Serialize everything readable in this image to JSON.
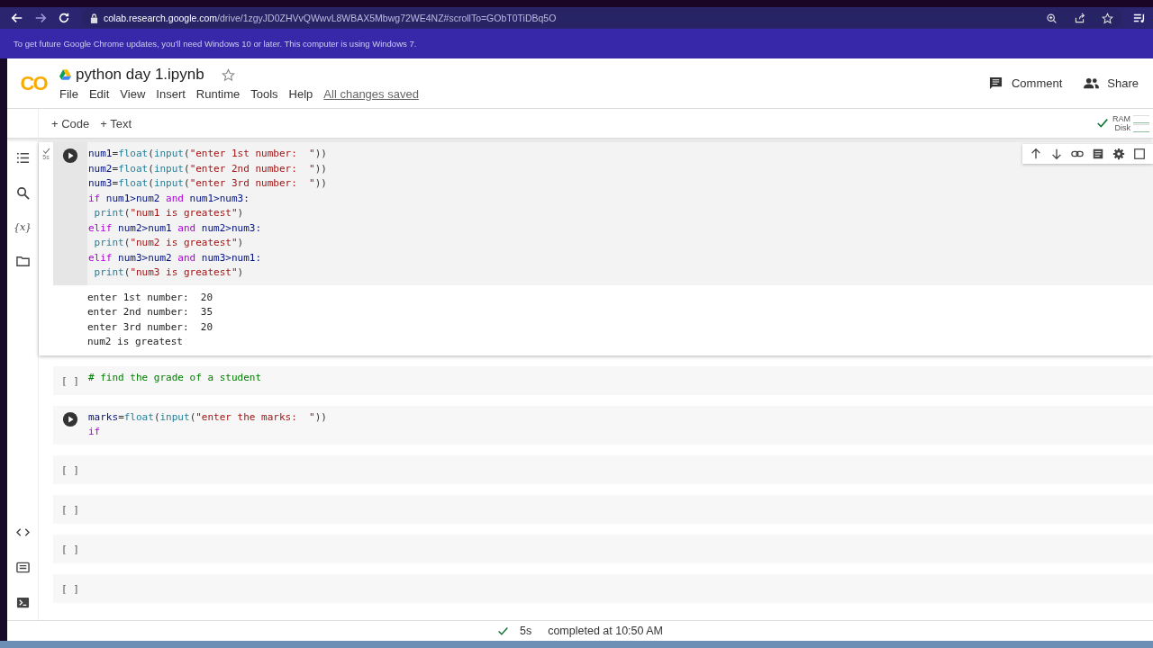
{
  "browser": {
    "url_host": "colab.research.google.com",
    "url_path": "/drive/1zgyJD0ZHVvQWwvL8WBAX5Mbwg72WE4NZ#scrollTo=GObT0TiDBq5O",
    "infobar": "To get future Google Chrome updates, you'll need Windows 10 or later. This computer is using Windows 7."
  },
  "header": {
    "logo": "CO",
    "title": "python day 1.ipynb",
    "menu": [
      "File",
      "Edit",
      "View",
      "Insert",
      "Runtime",
      "Tools",
      "Help"
    ],
    "save_status": "All changes saved",
    "actions": [
      "Comment",
      "Share"
    ]
  },
  "sidebar": {
    "variables_icon": "{x}"
  },
  "toolbar": {
    "buttons": [
      "+ Code",
      "+ Text"
    ],
    "resources": [
      "RAM",
      "Disk"
    ]
  },
  "cells": [
    {
      "kind": "run",
      "selected": true,
      "exec_time": "5s",
      "lines": [
        [
          {
            "t": "num1",
            "kind": "name"
          },
          {
            "t": "=",
            "kind": "operator"
          },
          {
            "t": "float",
            "kind": "function"
          },
          {
            "t": "(",
            "kind": "operator"
          },
          {
            "t": "input",
            "kind": "function"
          },
          {
            "t": "(",
            "kind": "operator"
          },
          {
            "t": "\"enter 1st number:  \"",
            "kind": "string"
          },
          {
            "t": "))",
            "kind": "operator"
          }
        ],
        [
          {
            "t": "num2",
            "kind": "name"
          },
          {
            "t": "=",
            "kind": "operator"
          },
          {
            "t": "float",
            "kind": "function"
          },
          {
            "t": "(",
            "kind": "operator"
          },
          {
            "t": "input",
            "kind": "function"
          },
          {
            "t": "(",
            "kind": "operator"
          },
          {
            "t": "\"enter 2nd number:  \"",
            "kind": "string"
          },
          {
            "t": "))",
            "kind": "operator"
          }
        ],
        [
          {
            "t": "num3",
            "kind": "name"
          },
          {
            "t": "=",
            "kind": "operator"
          },
          {
            "t": "float",
            "kind": "function"
          },
          {
            "t": "(",
            "kind": "operator"
          },
          {
            "t": "input",
            "kind": "function"
          },
          {
            "t": "(",
            "kind": "operator"
          },
          {
            "t": "\"enter 3rd number:  \"",
            "kind": "string"
          },
          {
            "t": "))",
            "kind": "operator"
          }
        ],
        [
          {
            "t": "if",
            "kind": "keyword"
          },
          {
            "t": " num1>num2 ",
            "kind": "name"
          },
          {
            "t": "and",
            "kind": "keyword"
          },
          {
            "t": " num1>num3:",
            "kind": "name"
          }
        ],
        [
          {
            "t": " print",
            "kind": "function"
          },
          {
            "t": "(",
            "kind": "operator"
          },
          {
            "t": "\"num1 is greatest\"",
            "kind": "string"
          },
          {
            "t": ")",
            "kind": "operator"
          }
        ],
        [
          {
            "t": "elif",
            "kind": "keyword"
          },
          {
            "t": " num2>num1 ",
            "kind": "name"
          },
          {
            "t": "and",
            "kind": "keyword"
          },
          {
            "t": " num2>num3:",
            "kind": "name"
          }
        ],
        [
          {
            "t": " print",
            "kind": "function"
          },
          {
            "t": "(",
            "kind": "operator"
          },
          {
            "t": "\"num2 is greatest\"",
            "kind": "string"
          },
          {
            "t": ")",
            "kind": "operator"
          }
        ],
        [
          {
            "t": "elif",
            "kind": "keyword"
          },
          {
            "t": " num3>num2 ",
            "kind": "name"
          },
          {
            "t": "and",
            "kind": "keyword"
          },
          {
            "t": " num3>num1:",
            "kind": "name"
          }
        ],
        [
          {
            "t": " print",
            "kind": "function"
          },
          {
            "t": "(",
            "kind": "operator"
          },
          {
            "t": "\"num3 is greatest\"",
            "kind": "string"
          },
          {
            "t": ")",
            "kind": "operator"
          }
        ]
      ],
      "output": [
        "enter 1st number:  20",
        "enter 2nd number:  35",
        "enter 3rd number:  20",
        "num2 is greatest"
      ]
    },
    {
      "kind": "idle",
      "selected": false,
      "prompt": "[ ]",
      "lines": [
        [
          {
            "t": "# find the grade of a student",
            "kind": "comment"
          }
        ]
      ]
    },
    {
      "kind": "run",
      "selected": false,
      "lines": [
        [
          {
            "t": "marks",
            "kind": "name"
          },
          {
            "t": "=",
            "kind": "operator"
          },
          {
            "t": "float",
            "kind": "function"
          },
          {
            "t": "(",
            "kind": "operator"
          },
          {
            "t": "input",
            "kind": "function"
          },
          {
            "t": "(",
            "kind": "operator"
          },
          {
            "t": "\"enter the marks:  \"",
            "kind": "string"
          },
          {
            "t": "))",
            "kind": "operator"
          }
        ],
        [
          {
            "t": "if",
            "kind": "keyword"
          }
        ]
      ]
    },
    {
      "kind": "idle",
      "selected": false,
      "prompt": "[ ]"
    },
    {
      "kind": "idle",
      "selected": false,
      "prompt": "[ ]"
    },
    {
      "kind": "idle",
      "selected": false,
      "prompt": "[ ]"
    },
    {
      "kind": "idle",
      "selected": false,
      "prompt": "[ ]"
    }
  ],
  "status_bar": {
    "duration": "5s",
    "message": "completed at 10:50 AM"
  }
}
